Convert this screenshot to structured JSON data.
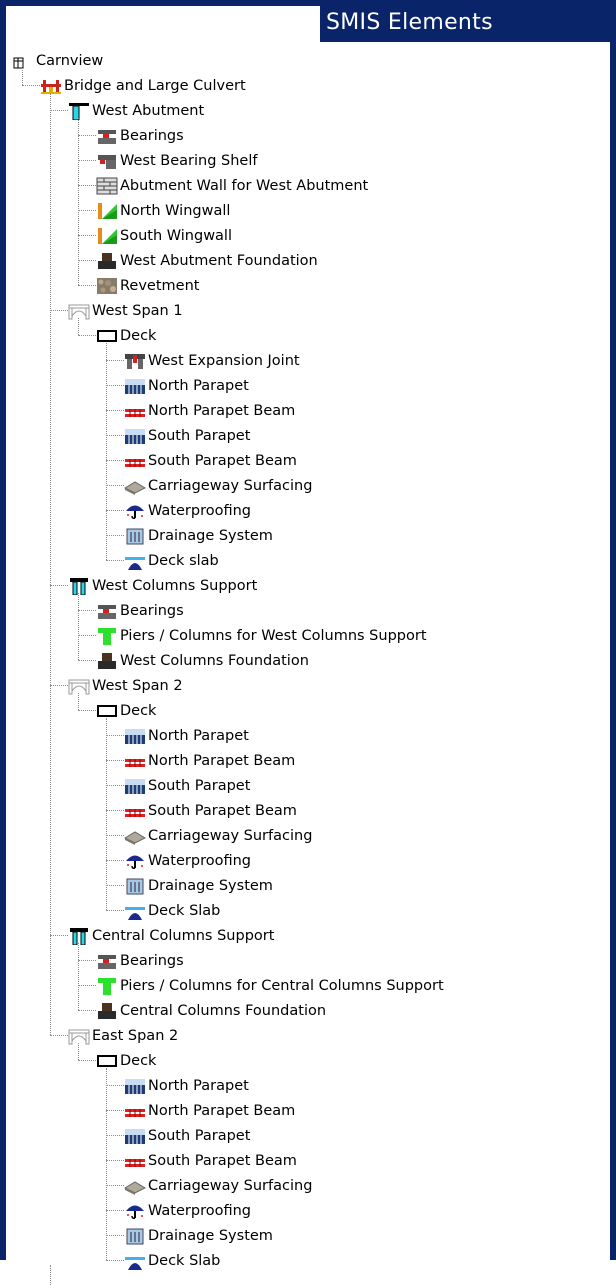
{
  "header": {
    "title": "SMIS Elements"
  },
  "tree": [
    {
      "label": "Carnview",
      "level": 0,
      "icon": "table-icon"
    },
    {
      "label": "Bridge and Large Culvert",
      "level": 1,
      "icon": "bridge-icon"
    },
    {
      "label": "West Abutment",
      "level": 2,
      "icon": "abutment-icon"
    },
    {
      "label": "Bearings",
      "level": 3,
      "icon": "bearing-icon"
    },
    {
      "label": "West Bearing Shelf",
      "level": 3,
      "icon": "bearing-shelf-icon"
    },
    {
      "label": "Abutment Wall for West Abutment",
      "level": 3,
      "icon": "brick-wall-icon"
    },
    {
      "label": "North Wingwall",
      "level": 3,
      "icon": "wingwall-icon"
    },
    {
      "label": "South Wingwall",
      "level": 3,
      "icon": "wingwall-icon"
    },
    {
      "label": "West Abutment Foundation",
      "level": 3,
      "icon": "foundation-icon"
    },
    {
      "label": "Revetment",
      "level": 3,
      "icon": "revetment-icon"
    },
    {
      "label": "West Span 1",
      "level": 2,
      "icon": "span-icon"
    },
    {
      "label": "Deck",
      "level": 3,
      "icon": "deck-icon"
    },
    {
      "label": "West Expansion Joint",
      "level": 4,
      "icon": "expansion-joint-icon"
    },
    {
      "label": "North Parapet",
      "level": 4,
      "icon": "parapet-icon"
    },
    {
      "label": "North Parapet Beam",
      "level": 4,
      "icon": "parapet-beam-icon"
    },
    {
      "label": "South Parapet",
      "level": 4,
      "icon": "parapet-icon"
    },
    {
      "label": "South Parapet Beam",
      "level": 4,
      "icon": "parapet-beam-icon"
    },
    {
      "label": "Carriageway Surfacing",
      "level": 4,
      "icon": "surfacing-icon"
    },
    {
      "label": "Waterproofing",
      "level": 4,
      "icon": "umbrella-icon"
    },
    {
      "label": "Drainage System",
      "level": 4,
      "icon": "drainage-icon"
    },
    {
      "label": "Deck slab",
      "level": 4,
      "icon": "deck-slab-icon"
    },
    {
      "label": "West Columns Support",
      "level": 2,
      "icon": "column-support-icon"
    },
    {
      "label": "Bearings",
      "level": 3,
      "icon": "bearing-icon"
    },
    {
      "label": "Piers / Columns for West Columns Support",
      "level": 3,
      "icon": "pier-icon"
    },
    {
      "label": "West Columns Foundation",
      "level": 3,
      "icon": "foundation-icon"
    },
    {
      "label": "West Span 2",
      "level": 2,
      "icon": "span-icon"
    },
    {
      "label": "Deck",
      "level": 3,
      "icon": "deck-icon"
    },
    {
      "label": "North Parapet",
      "level": 4,
      "icon": "parapet-icon"
    },
    {
      "label": "North Parapet Beam",
      "level": 4,
      "icon": "parapet-beam-icon"
    },
    {
      "label": "South Parapet",
      "level": 4,
      "icon": "parapet-icon"
    },
    {
      "label": "South Parapet Beam",
      "level": 4,
      "icon": "parapet-beam-icon"
    },
    {
      "label": "Carriageway Surfacing",
      "level": 4,
      "icon": "surfacing-icon"
    },
    {
      "label": "Waterproofing",
      "level": 4,
      "icon": "umbrella-icon"
    },
    {
      "label": "Drainage System",
      "level": 4,
      "icon": "drainage-icon"
    },
    {
      "label": "Deck Slab",
      "level": 4,
      "icon": "deck-slab-icon"
    },
    {
      "label": "Central Columns Support",
      "level": 2,
      "icon": "column-support-icon"
    },
    {
      "label": "Bearings",
      "level": 3,
      "icon": "bearing-icon"
    },
    {
      "label": "Piers / Columns for Central Columns Support",
      "level": 3,
      "icon": "pier-icon"
    },
    {
      "label": "Central Columns Foundation",
      "level": 3,
      "icon": "foundation-icon"
    },
    {
      "label": "East Span 2",
      "level": 2,
      "icon": "span-icon"
    },
    {
      "label": "Deck",
      "level": 3,
      "icon": "deck-icon"
    },
    {
      "label": "North Parapet",
      "level": 4,
      "icon": "parapet-icon"
    },
    {
      "label": "North Parapet Beam",
      "level": 4,
      "icon": "parapet-beam-icon"
    },
    {
      "label": "South Parapet",
      "level": 4,
      "icon": "parapet-icon"
    },
    {
      "label": "South Parapet Beam",
      "level": 4,
      "icon": "parapet-beam-icon"
    },
    {
      "label": "Carriageway Surfacing",
      "level": 4,
      "icon": "surfacing-icon"
    },
    {
      "label": "Waterproofing",
      "level": 4,
      "icon": "umbrella-icon"
    },
    {
      "label": "Drainage System",
      "level": 4,
      "icon": "drainage-icon"
    },
    {
      "label": "Deck Slab",
      "level": 4,
      "icon": "deck-slab-icon"
    }
  ]
}
